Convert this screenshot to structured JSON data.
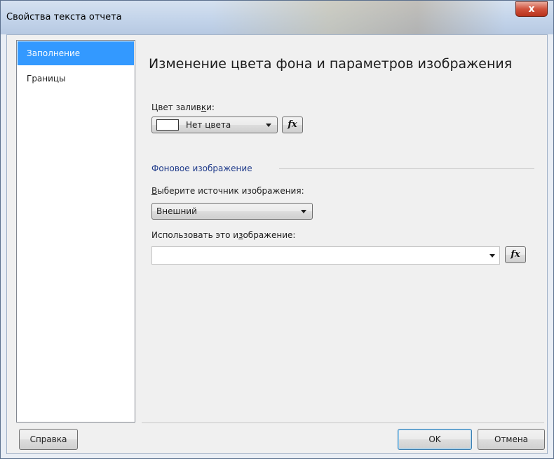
{
  "window": {
    "title": "Свойства текста отчета",
    "close_glyph": "x"
  },
  "nav": {
    "items": [
      {
        "label": "Заполнение",
        "active": true
      },
      {
        "label": "Границы",
        "active": false
      }
    ]
  },
  "content": {
    "heading": "Изменение цвета фона и параметров изображения",
    "fill_color_label": {
      "pre": "Цвет залив",
      "accel": "к",
      "post": "и:"
    },
    "fill_color_value": "Нет цвета",
    "fx_label": "fx",
    "background_group_title": "Фоновое изображение",
    "source_label": {
      "pre": "",
      "accel": "В",
      "post": "ыберите источник изображения:"
    },
    "source_value": "Внешний",
    "use_image_label": {
      "pre": "Использовать это и",
      "accel": "з",
      "post": "ображение:"
    },
    "use_image_value": ""
  },
  "footer": {
    "help_label": "Справка",
    "ok_label": "OK",
    "cancel_label": "Отмена"
  },
  "colors": {
    "accent": "#3399ff",
    "close_button": "#c8402a",
    "group_title": "#1e3a8a"
  },
  "icons": [
    "close-icon",
    "dropdown-arrow-icon",
    "fx-icon"
  ]
}
